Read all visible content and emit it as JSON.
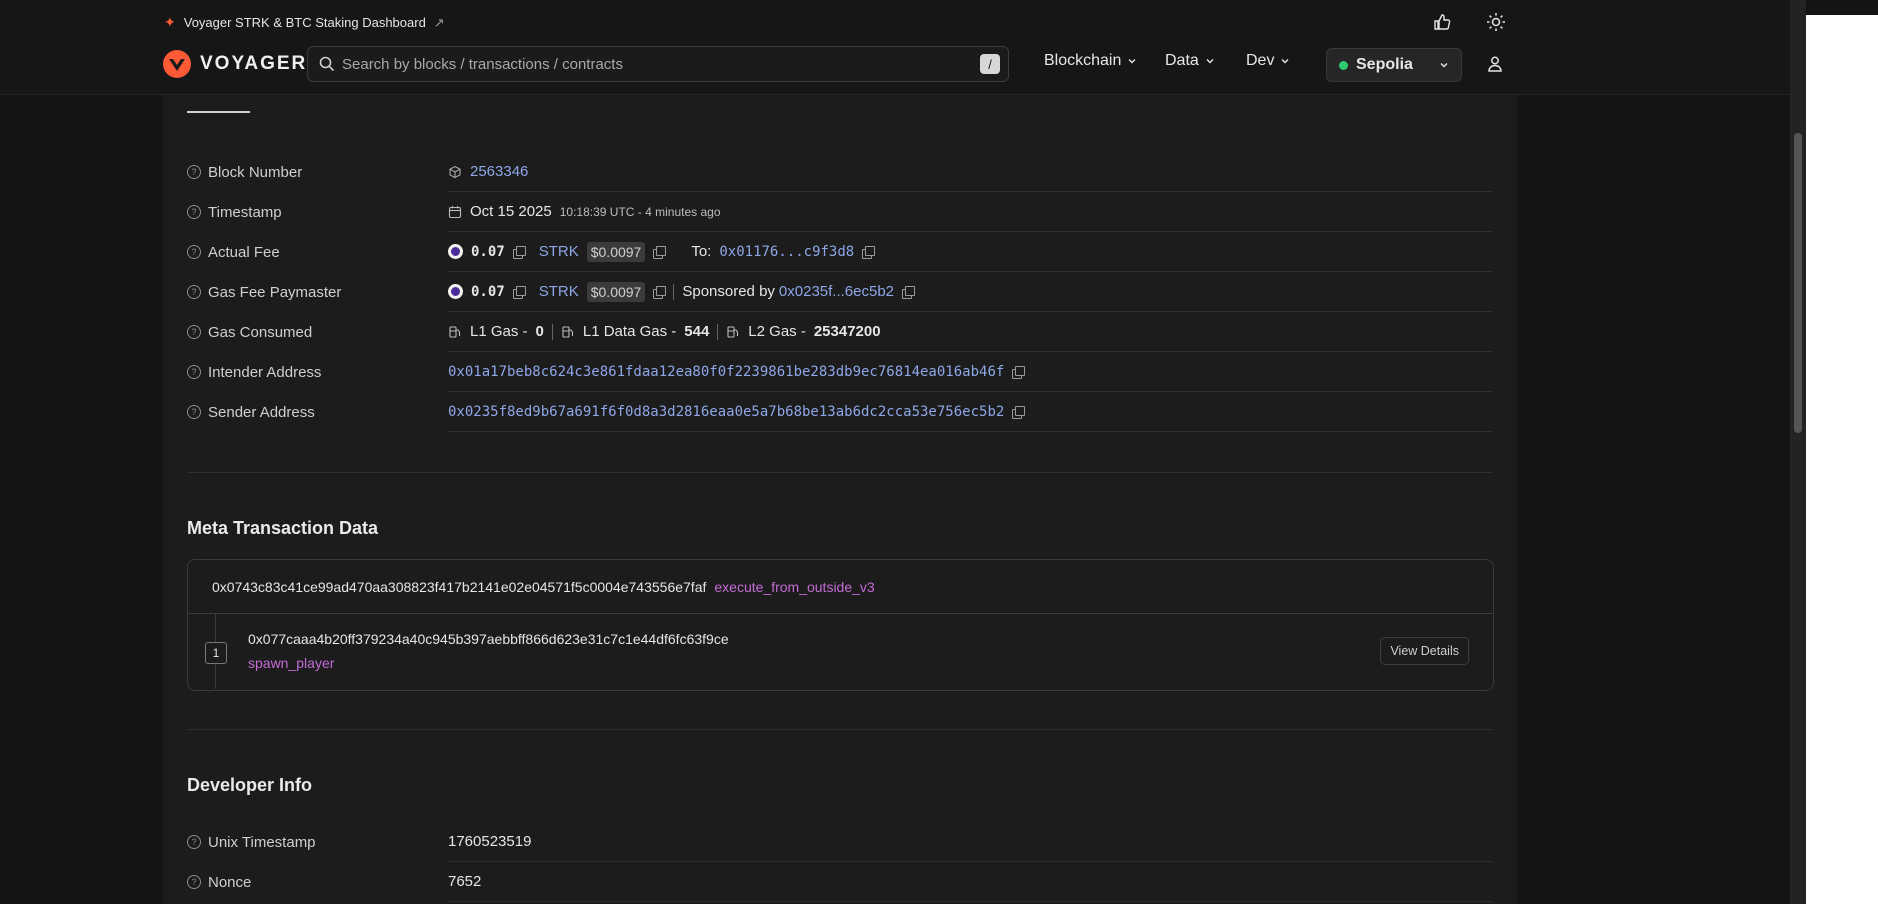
{
  "banner": {
    "text": "Voyager STRK & BTC Staking Dashboard"
  },
  "header": {
    "brand": "VOYAGER",
    "search_placeholder": "Search by blocks / transactions / contracts",
    "search_shortcut": "/",
    "nav": [
      {
        "label": "Blockchain"
      },
      {
        "label": "Data"
      },
      {
        "label": "Dev"
      }
    ],
    "network": "Sepolia",
    "network_status_color": "#2ecc71"
  },
  "details": {
    "block_number": {
      "label": "Block Number",
      "value": "2563346"
    },
    "timestamp": {
      "label": "Timestamp",
      "date": "Oct 15 2025",
      "time": "10:18:39 UTC - 4 minutes ago"
    },
    "actual_fee": {
      "label": "Actual Fee",
      "amount": "0.07",
      "token": "STRK",
      "usd": "$0.0097",
      "to_label": "To:",
      "to": "0x01176...c9f3d8"
    },
    "gas_fee_paymaster": {
      "label": "Gas Fee Paymaster",
      "amount": "0.07",
      "token": "STRK",
      "usd": "$0.0097",
      "sponsored_label": "Sponsored by",
      "sponsor": "0x0235f...6ec5b2"
    },
    "gas_consumed": {
      "label": "Gas Consumed",
      "l1_label": "L1 Gas -",
      "l1": "0",
      "l1_data_label": "L1 Data Gas -",
      "l1_data": "544",
      "l2_label": "L2 Gas -",
      "l2": "25347200"
    },
    "intender_address": {
      "label": "Intender Address",
      "value": "0x01a17beb8c624c3e861fdaa12ea80f0f2239861be283db9ec76814ea016ab46f"
    },
    "sender_address": {
      "label": "Sender Address",
      "value": "0x0235f8ed9b67a691f6f0d8a3d2816eaa0e5a7b68be13ab6dc2cca53e756ec5b2"
    }
  },
  "meta": {
    "title": "Meta Transaction Data",
    "contract": "0x0743c83c41ce99ad470aa308823f417b2141e02e04571f5c0004e743556e7faf",
    "entrypoint": "execute_from_outside_v3",
    "calls": [
      {
        "index": "1",
        "address": "0x077caaa4b20ff379234a40c945b397aebbff866d623e31c7c1e44df6fc63f9ce",
        "function": "spawn_player",
        "button": "View Details"
      }
    ]
  },
  "developer": {
    "title": "Developer Info",
    "unix_timestamp": {
      "label": "Unix Timestamp",
      "value": "1760523519"
    },
    "nonce": {
      "label": "Nonce",
      "value": "7652"
    }
  },
  "colors": {
    "accent_link": "#8ea7e8",
    "function_purple": "#c46bd6",
    "brand_orange": "#ff5a36"
  }
}
